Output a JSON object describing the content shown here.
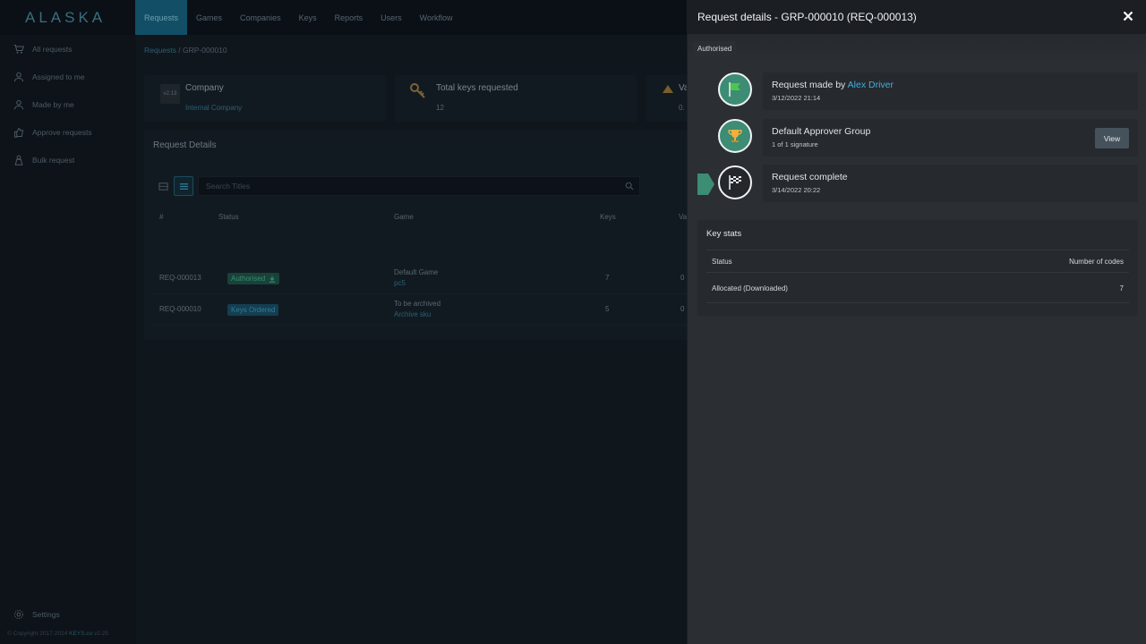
{
  "app": {
    "logo": "ALASKA"
  },
  "topnav": [
    {
      "label": "Requests",
      "active": true
    },
    {
      "label": "Games"
    },
    {
      "label": "Companies"
    },
    {
      "label": "Keys"
    },
    {
      "label": "Reports"
    },
    {
      "label": "Users"
    },
    {
      "label": "Workflow"
    }
  ],
  "sidebar": {
    "items": [
      {
        "label": "All requests",
        "icon": "cart-icon"
      },
      {
        "label": "Assigned to me",
        "icon": "user-icon"
      },
      {
        "label": "Made by me",
        "icon": "user-icon"
      },
      {
        "label": "Approve requests",
        "icon": "thumbs-up-icon"
      },
      {
        "label": "Bulk request",
        "icon": "bulk-icon"
      }
    ],
    "settings_label": "Settings",
    "copyright": "© Copyright 2017-2024",
    "brand": "KEYS.co",
    "version": "v2.25"
  },
  "breadcrumb": {
    "root": "Requests",
    "sep": "/",
    "current": "GRP-000010"
  },
  "cards": {
    "company": {
      "title": "Company",
      "value": "Internal Company",
      "thumb": "v2.13"
    },
    "keys": {
      "title": "Total keys requested",
      "value": "12"
    },
    "value": {
      "title": "Va",
      "value": "0."
    }
  },
  "panel": {
    "title": "Request Details",
    "search_placeholder": "Search Titles",
    "columns": {
      "num": "#",
      "status": "Status",
      "game": "Game",
      "keys": "Keys",
      "value": "Va"
    },
    "rows": [
      {
        "id": "REQ-000013",
        "status": "Authorised",
        "game": "Default Game",
        "sku": "pc5",
        "keys": "7",
        "value": "0"
      },
      {
        "id": "REQ-000010",
        "status": "Keys Ordered",
        "game": "To be archived",
        "sku": "Archive sku",
        "keys": "5",
        "value": "0"
      }
    ]
  },
  "drawer": {
    "title": "Request details - GRP-000010 (REQ-000013)",
    "status": "Authorised",
    "steps": [
      {
        "title_prefix": "Request made by",
        "link": "Alex Driver",
        "sub": "3/12/2022 21:14",
        "icon": "flag-icon"
      },
      {
        "title": "Default Approver Group",
        "sub": "1 of 1 signature",
        "button": "View",
        "icon": "trophy-icon"
      },
      {
        "title": "Request complete",
        "sub": "3/14/2022 20:22",
        "icon": "checkered-flag-icon"
      }
    ],
    "stats": {
      "title": "Key stats",
      "col_status": "Status",
      "col_codes": "Number of codes",
      "rows": [
        {
          "status": "Allocated (Downloaded)",
          "codes": "7"
        }
      ]
    }
  },
  "colors": {
    "accent": "#3fb0dc",
    "done": "#3d8c74",
    "nav_active": "#124e66"
  }
}
